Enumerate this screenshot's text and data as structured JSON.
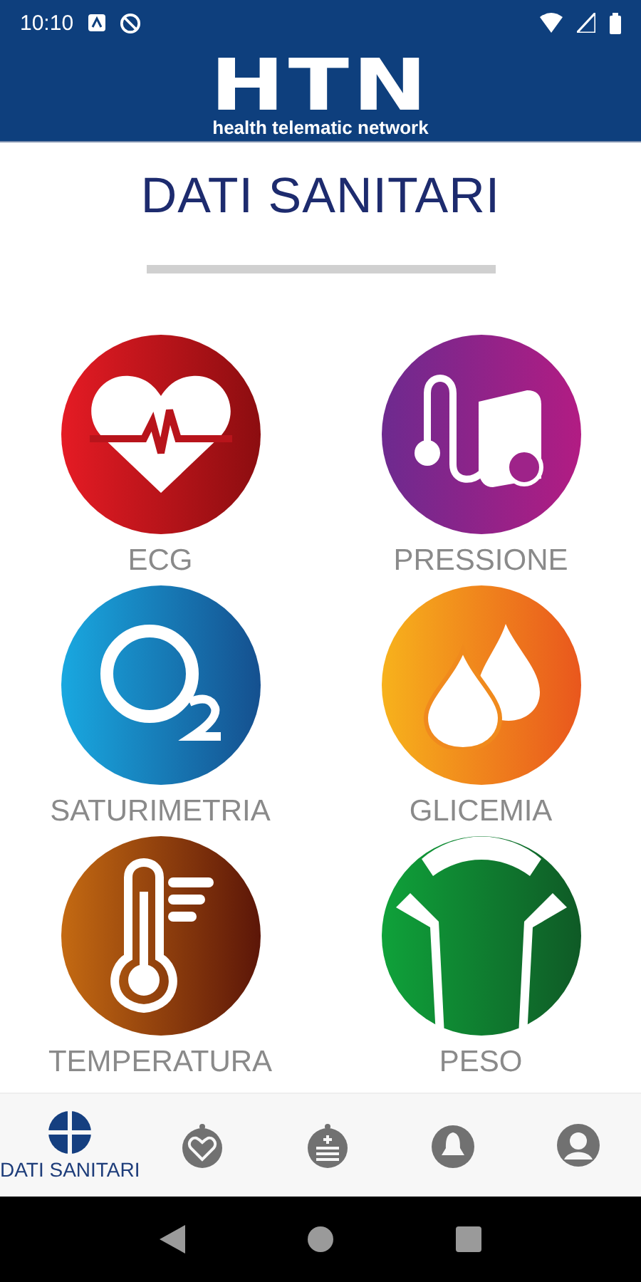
{
  "status_bar": {
    "time": "10:10"
  },
  "header": {
    "logo": "HTN",
    "tagline": "health telematic network"
  },
  "title": "DATI SANITARI",
  "tiles": [
    {
      "kind": "ecg",
      "label": "ECG"
    },
    {
      "kind": "pressure",
      "label": "PRESSIONE"
    },
    {
      "kind": "oxygen",
      "label": "SATURIMETRIA"
    },
    {
      "kind": "glucose",
      "label": "GLICEMIA"
    },
    {
      "kind": "temperature",
      "label": "TEMPERATURA"
    },
    {
      "kind": "weight",
      "label": "PESO"
    }
  ],
  "bottom_nav": [
    {
      "kind": "data",
      "label": "DATI SANITARI",
      "selected": true
    },
    {
      "kind": "heart",
      "selected": false
    },
    {
      "kind": "list",
      "selected": false
    },
    {
      "kind": "bell",
      "selected": false
    },
    {
      "kind": "profile",
      "selected": false
    }
  ]
}
